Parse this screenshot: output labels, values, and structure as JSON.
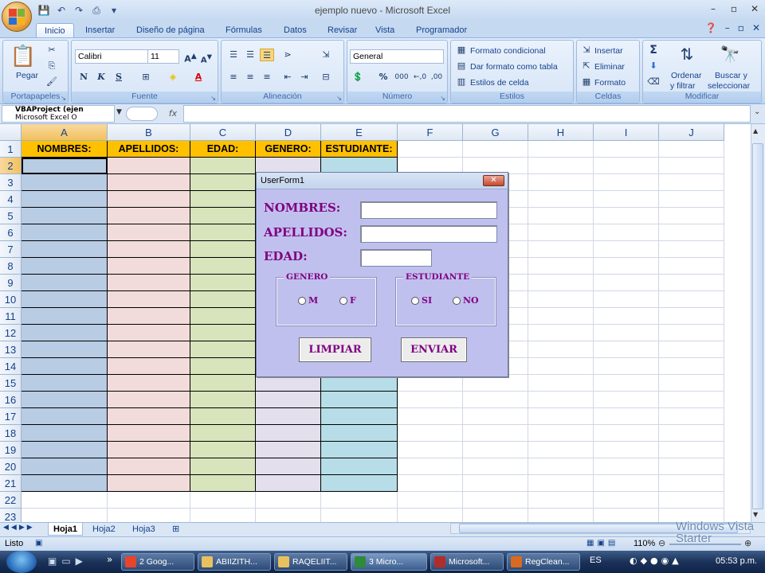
{
  "window": {
    "title": "ejemplo nuevo - Microsoft Excel"
  },
  "tabs": [
    "Inicio",
    "Insertar",
    "Diseño de página",
    "Fórmulas",
    "Datos",
    "Revisar",
    "Vista",
    "Programador"
  ],
  "ribbon": {
    "portapapeles": {
      "label": "Portapapeles",
      "paste": "Pegar"
    },
    "fuente": {
      "label": "Fuente",
      "font": "Calibri",
      "size": "11",
      "bold": "N",
      "italic": "K",
      "underline": "S"
    },
    "alineacion": {
      "label": "Alineación"
    },
    "numero": {
      "label": "Número",
      "format": "General",
      "percent": "%",
      "thousands": "000",
      "inc": "←,0",
      "dec": ",00"
    },
    "estilos": {
      "label": "Estilos",
      "cond": "Formato condicional",
      "table": "Dar formato como tabla",
      "cell": "Estilos de celda"
    },
    "celdas": {
      "label": "Celdas",
      "insert": "Insertar",
      "delete": "Eliminar",
      "format": "Formato"
    },
    "modificar": {
      "label": "Modificar",
      "sort1": "Ordenar",
      "sort2": "y filtrar",
      "find1": "Buscar y",
      "find2": "seleccionar"
    }
  },
  "formula_bar": {
    "tree1": "VBAProject (ejen",
    "tree2": "Microsoft Excel O",
    "fx": "fx"
  },
  "sheet": {
    "columns": [
      "A",
      "B",
      "C",
      "D",
      "E",
      "F",
      "G",
      "H",
      "I",
      "J"
    ],
    "rows": [
      "1",
      "2",
      "3",
      "4",
      "5",
      "6",
      "7",
      "8",
      "9",
      "10",
      "11",
      "12",
      "13",
      "14",
      "15",
      "16",
      "17",
      "18",
      "19",
      "20",
      "21",
      "22",
      "23"
    ],
    "headers": [
      "NOMBRES:",
      "APELLIDOS:",
      "EDAD:",
      "GENERO:",
      "ESTUDIANTE:"
    ],
    "header_color": "#ffc000",
    "column_colors": [
      "#b8cce4",
      "#f2dcdb",
      "#d8e4bc",
      "#e4dfec",
      "#b7dee8"
    ]
  },
  "sheet_tabs": [
    "Hoja1",
    "Hoja2",
    "Hoja3"
  ],
  "status": {
    "ready": "Listo",
    "zoom": "110%"
  },
  "taskbar": {
    "items": [
      "2 Goog...",
      "ABIIZITH...",
      "RAQELIIT...",
      "3 Micro...",
      "Microsoft...",
      "RegClean..."
    ],
    "lang": "ES",
    "time": "05:53 p.m."
  },
  "watermark": {
    "line1": "Windows Vista",
    "line2": "Starter"
  },
  "userform": {
    "title": "UserForm1",
    "close": "✕",
    "nombres_label": "NOMBRES:",
    "apellidos_label": "APELLIDOS:",
    "edad_label": "EDAD:",
    "genero_label": "GENERO",
    "genero_m": "M",
    "genero_f": "F",
    "estudiante_label": "ESTUDIANTE",
    "estudiante_si": "SI",
    "estudiante_no": "NO",
    "limpiar": "LIMPIAR",
    "enviar": "ENVIAR",
    "label_color": "#800080",
    "bg_color": "#c0c0ee"
  }
}
